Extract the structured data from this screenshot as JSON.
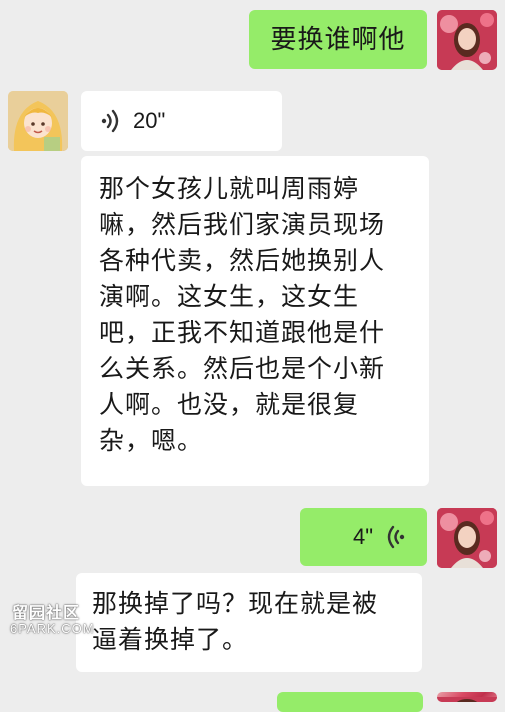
{
  "messages": {
    "m1_text": "要换谁啊他",
    "voice1_duration": "20\"",
    "m3_lines": [
      "那个女孩儿就叫周雨婷",
      "嘛，然后我们家演员现场",
      "各种代卖，然后她换别人",
      "演啊。这女生，这女生",
      "吧，正我不知道跟他是什",
      "么关系。然后也是个小新",
      "人啊。也没，就是很复",
      "杂，嗯。"
    ],
    "voice2_duration": "4\"",
    "m5_lines": [
      "那换掉了吗？现在就是被",
      "逼着换掉了。"
    ]
  },
  "watermark": {
    "cn": "留园社区",
    "en": "6PARK.COM"
  },
  "icons": {
    "voice_in": "voice-wave-icon",
    "voice_out": "voice-wave-icon",
    "avatar_left": "user-avatar-icon",
    "avatar_right": "user-avatar-icon"
  },
  "colors": {
    "background": "#ededed",
    "incoming_bubble": "#ffffff",
    "outgoing_bubble": "#95ec69"
  }
}
